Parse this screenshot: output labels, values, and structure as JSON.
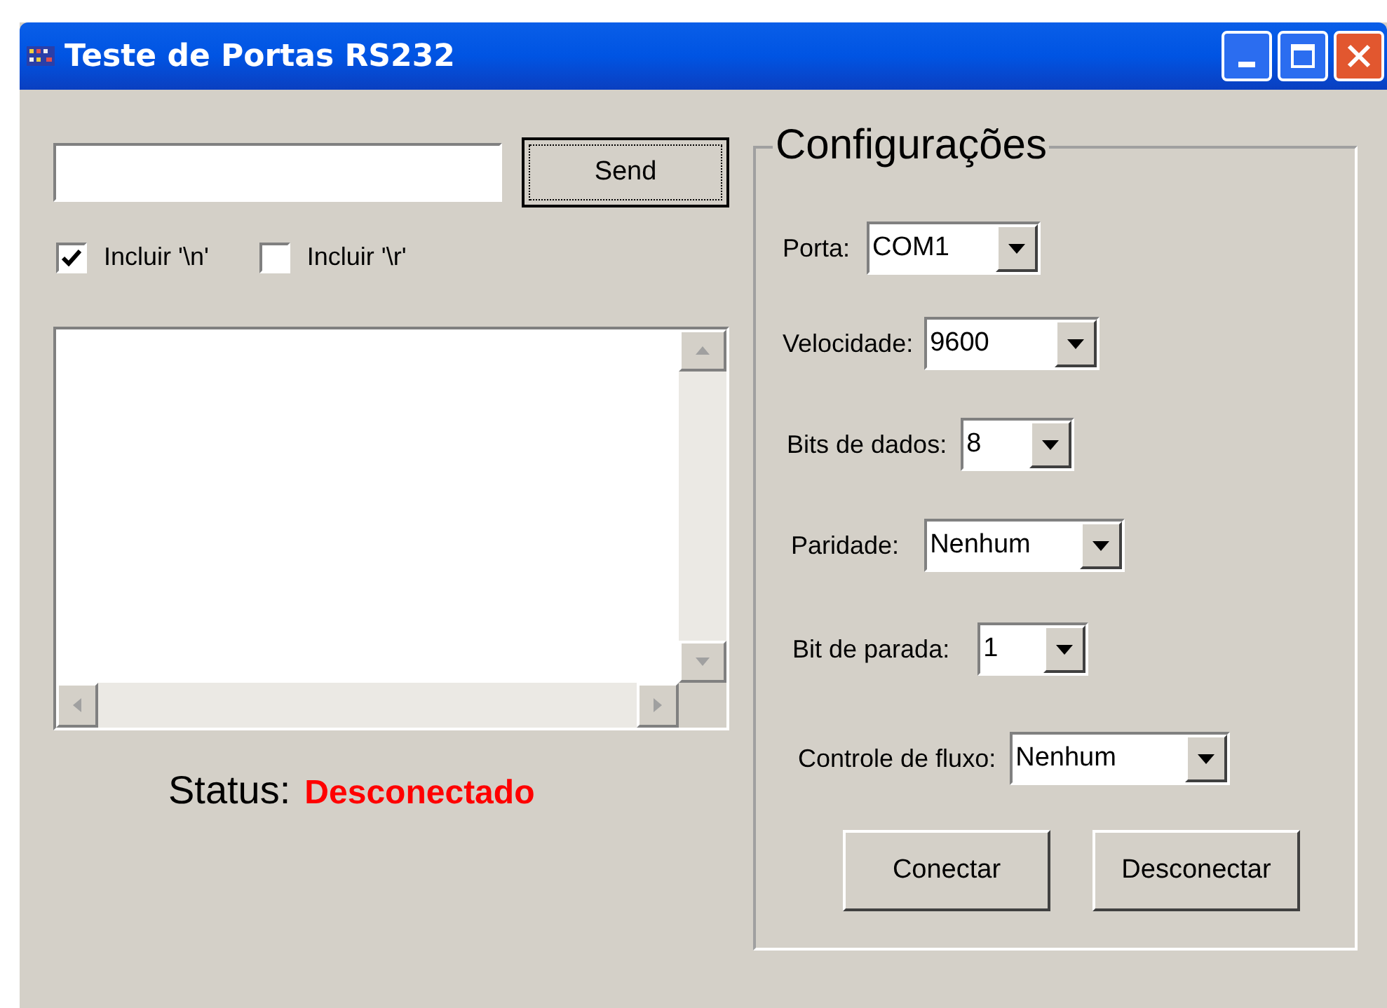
{
  "window": {
    "title": "Teste de Portas RS232"
  },
  "send_button": "Send",
  "options": [
    {
      "label": "Incluir '\\n'",
      "checked": true
    },
    {
      "label": "Incluir '\\r'",
      "checked": false
    }
  ],
  "status": {
    "label": "Status:",
    "value": "Desconectado"
  },
  "settings": {
    "title": "Configurações",
    "fields": [
      {
        "label": "Porta:",
        "value": "COM1"
      },
      {
        "label": "Velocidade:",
        "value": "9600"
      },
      {
        "label": "Bits de dados:",
        "value": "8"
      },
      {
        "label": "Paridade:",
        "value": "Nenhum"
      },
      {
        "label": "Bit de parada:",
        "value": "1"
      },
      {
        "label": "Controle de fluxo:",
        "value": "Nenhum"
      }
    ]
  },
  "buttons": [
    "Conectar",
    "Desconectar"
  ]
}
